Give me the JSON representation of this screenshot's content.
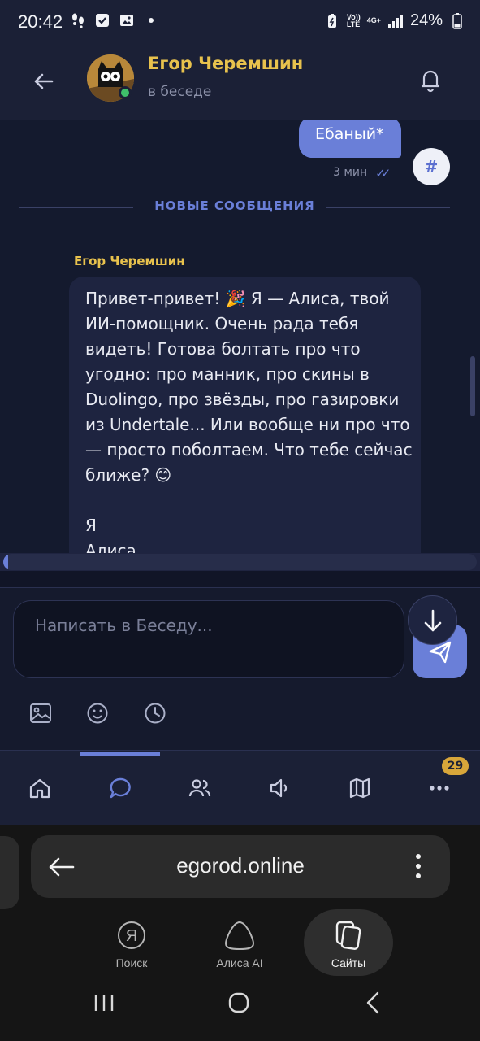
{
  "status_bar": {
    "time": "20:42",
    "battery": "24%",
    "net_top": "Vo))",
    "net_bottom": "LTE",
    "gen_top": "4G+"
  },
  "header": {
    "title": "Егор Черемшин",
    "subtitle": "в беседе"
  },
  "messages": {
    "outgoing": {
      "text": "Ебаный*",
      "time": "3 мин",
      "checks": "✓✓"
    },
    "hash_label": "#",
    "divider": "НОВЫЕ СООБЩЕНИЯ",
    "incoming": {
      "sender": "Егор Черемшин",
      "lines": [
        "Привет-привет! 🎉 Я — Алиса, твой",
        "ИИ-помощник. Очень рада тебя",
        "видеть! Готова болтать про что",
        "угодно: про манник, про скины в",
        "Duolingo, про звёзды, про газировки",
        "из Undertale... Или вообще ни про что",
        "— просто поболтаем. Что тебе сейчас",
        "ближе? 😊",
        "",
        "Я",
        "Алиса"
      ]
    }
  },
  "composer": {
    "placeholder": "Написать в Беседу..."
  },
  "nav": {
    "badge": "29"
  },
  "browser": {
    "url": "egorod.online",
    "tabs": [
      {
        "label": "Поиск"
      },
      {
        "label": "Алиса AI"
      },
      {
        "label": "Сайты"
      }
    ],
    "search_glyph": "Я"
  }
}
